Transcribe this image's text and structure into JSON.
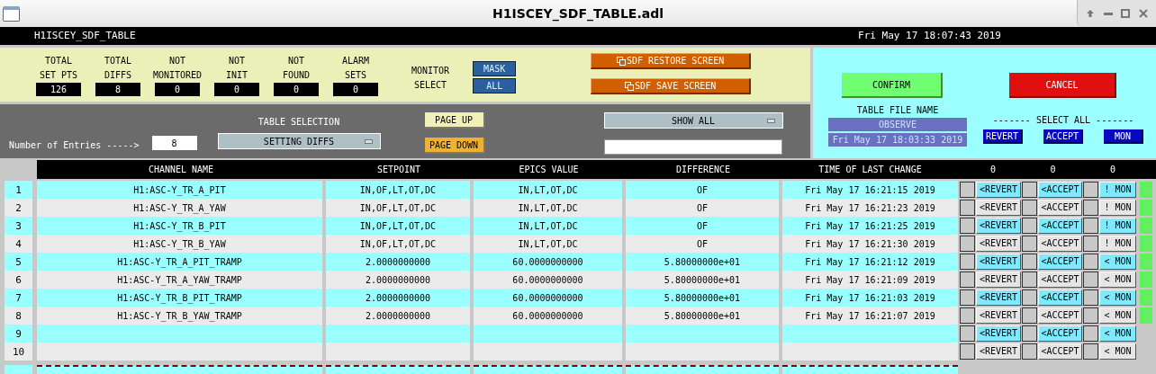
{
  "window": {
    "title": "H1ISCEY_SDF_TABLE.adl"
  },
  "header": {
    "name": "H1ISCEY_SDF_TABLE",
    "time": "Fri May 17 18:07:43 2019"
  },
  "stats": [
    {
      "label": [
        "TOTAL",
        "SET PTS"
      ],
      "value": "126"
    },
    {
      "label": [
        "TOTAL",
        "DIFFS"
      ],
      "value": "8"
    },
    {
      "label": [
        "NOT",
        "MONITORED"
      ],
      "value": "0"
    },
    {
      "label": [
        "NOT",
        "INIT"
      ],
      "value": "0"
    },
    {
      "label": [
        "NOT",
        "FOUND"
      ],
      "value": "0"
    },
    {
      "label": [
        "ALARM",
        "SETS"
      ],
      "value": "0"
    }
  ],
  "monitor_select": {
    "label": [
      "MONITOR",
      "SELECT"
    ],
    "options": [
      "MASK",
      "ALL"
    ]
  },
  "screen_buttons": [
    "SDF RESTORE SCREEN",
    "SDF SAVE SCREEN"
  ],
  "entries": {
    "label": "Number of Entries ----->",
    "value": "8"
  },
  "table_selection": {
    "label": "TABLE SELECTION",
    "value": "SETTING DIFFS"
  },
  "page_buttons": [
    {
      "label": "PAGE UP",
      "kind": "up"
    },
    {
      "label": "PAGE DOWN",
      "kind": "down"
    }
  ],
  "filter": {
    "value": "SHOW ALL"
  },
  "confirm": "CONFIRM",
  "cancel": "CANCEL",
  "table_file": {
    "label": "TABLE FILE NAME",
    "name": "OBSERVE",
    "date": "Fri May 17 18:03:33 2019"
  },
  "select_all": {
    "label": "------- SELECT ALL -------",
    "buttons": [
      "REVERT",
      "ACCEPT",
      "MON"
    ]
  },
  "table": {
    "columns": [
      "CHANNEL NAME",
      "SETPOINT",
      "EPICS VALUE",
      "DIFFERENCE",
      "TIME OF LAST CHANGE"
    ],
    "counts": [
      "0",
      "0",
      "0"
    ],
    "rows": [
      {
        "kind": "entry",
        "num": "1",
        "channel": "H1:ASC-Y_TR_A_PIT",
        "setpoint": "IN,OF,LT,OT,DC",
        "epics": "IN,LT,OT,DC",
        "difference": "OF",
        "time": "Fri May 17 16:21:15 2019",
        "revert": "<REVERT",
        "accept": "<ACCEPT",
        "mon": "! MON",
        "flag": true
      },
      {
        "kind": "entry",
        "num": "2",
        "channel": "H1:ASC-Y_TR_A_YAW",
        "setpoint": "IN,OF,LT,OT,DC",
        "epics": "IN,LT,OT,DC",
        "difference": "OF",
        "time": "Fri May 17 16:21:23 2019",
        "revert": "<REVERT",
        "accept": "<ACCEPT",
        "mon": "! MON",
        "flag": true
      },
      {
        "kind": "entry",
        "num": "3",
        "channel": "H1:ASC-Y_TR_B_PIT",
        "setpoint": "IN,OF,LT,OT,DC",
        "epics": "IN,LT,OT,DC",
        "difference": "OF",
        "time": "Fri May 17 16:21:25 2019",
        "revert": "<REVERT",
        "accept": "<ACCEPT",
        "mon": "! MON",
        "flag": true
      },
      {
        "kind": "entry",
        "num": "4",
        "channel": "H1:ASC-Y_TR_B_YAW",
        "setpoint": "IN,OF,LT,OT,DC",
        "epics": "IN,LT,OT,DC",
        "difference": "OF",
        "time": "Fri May 17 16:21:30 2019",
        "revert": "<REVERT",
        "accept": "<ACCEPT",
        "mon": "! MON",
        "flag": true
      },
      {
        "kind": "entry",
        "num": "5",
        "channel": "H1:ASC-Y_TR_A_PIT_TRAMP",
        "setpoint": "2.0000000000",
        "epics": "60.0000000000",
        "difference": "5.80000000e+01",
        "time": "Fri May 17 16:21:12 2019",
        "revert": "<REVERT",
        "accept": "<ACCEPT",
        "mon": "< MON",
        "flag": true
      },
      {
        "kind": "entry",
        "num": "6",
        "channel": "H1:ASC-Y_TR_A_YAW_TRAMP",
        "setpoint": "2.0000000000",
        "epics": "60.0000000000",
        "difference": "5.80000000e+01",
        "time": "Fri May 17 16:21:09 2019",
        "revert": "<REVERT",
        "accept": "<ACCEPT",
        "mon": "< MON",
        "flag": true
      },
      {
        "kind": "entry",
        "num": "7",
        "channel": "H1:ASC-Y_TR_B_PIT_TRAMP",
        "setpoint": "2.0000000000",
        "epics": "60.0000000000",
        "difference": "5.80000000e+01",
        "time": "Fri May 17 16:21:03 2019",
        "revert": "<REVERT",
        "accept": "<ACCEPT",
        "mon": "< MON",
        "flag": true
      },
      {
        "kind": "entry",
        "num": "8",
        "channel": "H1:ASC-Y_TR_B_YAW_TRAMP",
        "setpoint": "2.0000000000",
        "epics": "60.0000000000",
        "difference": "5.80000000e+01",
        "time": "Fri May 17 16:21:07 2019",
        "revert": "<REVERT",
        "accept": "<ACCEPT",
        "mon": "< MON",
        "flag": true
      },
      {
        "kind": "entry",
        "num": "9",
        "revert": "<REVERT",
        "accept": "<ACCEPT",
        "mon": "< MON",
        "flag": false
      },
      {
        "kind": "entry",
        "num": "10",
        "revert": "<REVERT",
        "accept": "<ACCEPT",
        "mon": "< MON",
        "flag": false
      },
      {
        "kind": "dashed"
      }
    ]
  }
}
